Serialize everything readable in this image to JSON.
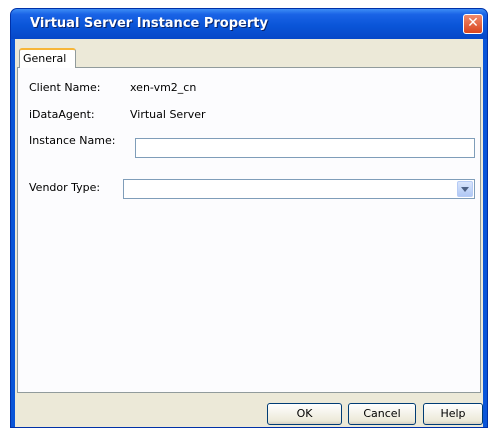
{
  "window": {
    "title": "Virtual Server Instance Property",
    "close_glyph": "✕"
  },
  "tabs": [
    {
      "label": "General",
      "selected": true
    }
  ],
  "form": {
    "client_name_label": "Client Name:",
    "client_name_value": "xen-vm2_cn",
    "idataagent_label": "iDataAgent:",
    "idataagent_value": "Virtual Server",
    "instance_name_label": "Instance Name:",
    "instance_name_value": "",
    "vendor_type_label": "Vendor Type:",
    "vendor_type_value": ""
  },
  "buttons": {
    "ok": "OK",
    "cancel": "Cancel",
    "help": "Help"
  },
  "colors": {
    "titlebar": "#0a55d8",
    "window_face": "#ece9d8",
    "tab_accent": "#f7b638",
    "close_button": "#d9451f"
  },
  "icons": {
    "close": "close-icon",
    "dropdown": "chevron-down-icon"
  }
}
